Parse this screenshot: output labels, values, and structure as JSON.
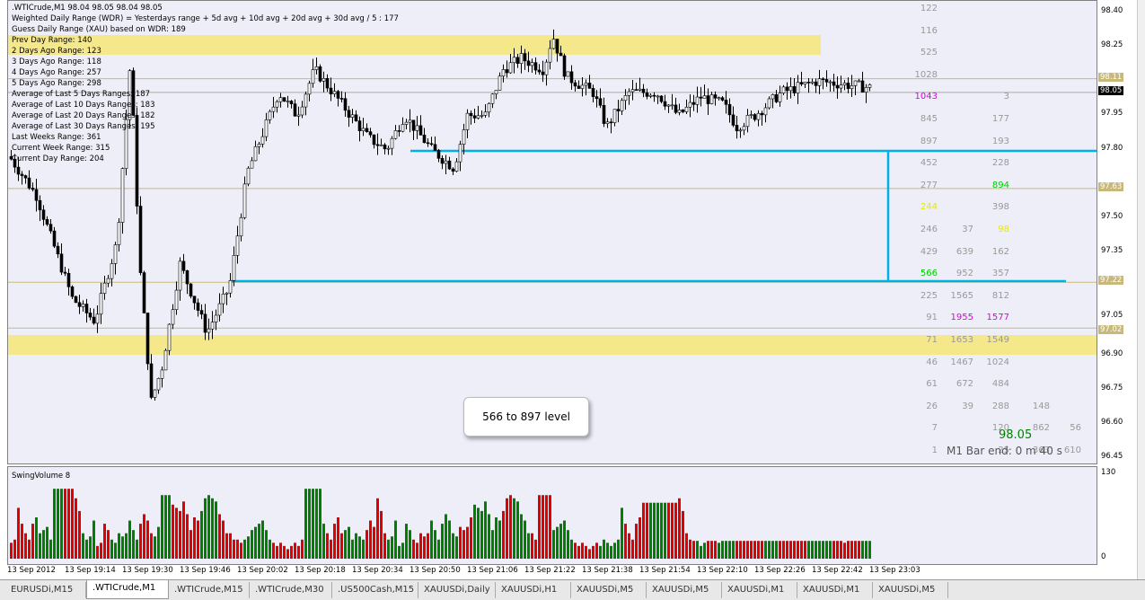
{
  "header": {
    "symbol_line": ".WTICrude,M1  98.04 98.05 98.04 98.05",
    "wdr_line": "Weighted Daily Range (WDR) = Yesterdays range + 5d avg + 10d avg + 20d avg + 30d avg / 5 : 177",
    "guess_line": "Guess Daily Range (XAU) based on WDR: 189"
  },
  "stats": [
    "Prev Day Range: 140",
    "2 Days Ago Range: 123",
    "3 Days Ago Range: 118",
    "4 Days Ago Range: 257",
    "5 Days Ago Range: 298",
    "Average of Last 5 Days Ranges: 187",
    "Average of Last 10 Days Ranges: 183",
    "Average of Last 20 Days Ranges: 182",
    "Average of Last 30 Days Ranges: 195",
    "Last Weeks Range: 361",
    "Current Week Range: 315",
    "Current Day Range: 204"
  ],
  "price_axis": [
    "98.40",
    "98.25",
    "98.11",
    "98.05",
    "97.95",
    "97.80",
    "97.63",
    "97.50",
    "97.35",
    "97.22",
    "97.05",
    "97.02",
    "96.90",
    "96.75",
    "96.60",
    "96.45"
  ],
  "price_highlights": {
    "98.11": "#c8b97a",
    "98.05": "#000000",
    "97.63": "#c8b97a",
    "97.22": "#c8b97a",
    "97.02": "#c8b97a"
  },
  "volume_profile": [
    {
      "c1": "122",
      "c2": "",
      "c3": "",
      "c4": ""
    },
    {
      "c1": "116",
      "c2": "",
      "c3": "",
      "c4": ""
    },
    {
      "c1": "525",
      "c2": "",
      "c3": "",
      "c4": ""
    },
    {
      "c1": "1028",
      "c2": "",
      "c3": "",
      "c4": ""
    },
    {
      "c1": "1043",
      "c2": "",
      "c3": "3",
      "c4": "",
      "c1color": "#e000e0"
    },
    {
      "c1": "845",
      "c2": "",
      "c3": "177",
      "c4": ""
    },
    {
      "c1": "897",
      "c2": "",
      "c3": "193",
      "c4": ""
    },
    {
      "c1": "452",
      "c2": "",
      "c3": "228",
      "c4": ""
    },
    {
      "c1": "277",
      "c2": "",
      "c3": "894",
      "c4": "",
      "c3color": "#00cc00"
    },
    {
      "c1": "244",
      "c2": "",
      "c3": "398",
      "c4": "",
      "c1color": "#e8e800"
    },
    {
      "c1": "246",
      "c2": "37",
      "c3": "98",
      "c4": "",
      "c3color": "#e8e800"
    },
    {
      "c1": "429",
      "c2": "639",
      "c3": "162",
      "c4": ""
    },
    {
      "c1": "566",
      "c2": "952",
      "c3": "357",
      "c4": "",
      "c1color": "#00cc00"
    },
    {
      "c1": "225",
      "c2": "1565",
      "c3": "812",
      "c4": ""
    },
    {
      "c1": "91",
      "c2": "1955",
      "c3": "1577",
      "c4": "",
      "c2color": "#e000e0",
      "c3color": "#e000e0"
    },
    {
      "c1": "71",
      "c2": "1653",
      "c3": "1549",
      "c4": ""
    },
    {
      "c1": "46",
      "c2": "1467",
      "c3": "1024",
      "c4": ""
    },
    {
      "c1": "61",
      "c2": "672",
      "c3": "484",
      "c4": ""
    },
    {
      "c1": "26",
      "c2": "39",
      "c3": "288",
      "c4": "148"
    },
    {
      "c1": "7",
      "c2": "",
      "c3": "120",
      "c4": "862",
      "c5": "56"
    },
    {
      "c1": "1",
      "c2": "",
      "c3": "25",
      "c4": "363",
      "c5": "610"
    }
  ],
  "current_price": "98.05",
  "bar_end": "M1 Bar end: 0 m 40 s",
  "callout": "566 to 897 level",
  "indicator": {
    "name": "SwingVolume 8",
    "max_label": "130",
    "min_label": "0"
  },
  "time_axis": [
    "13 Sep 2012",
    "13 Sep 19:14",
    "13 Sep 19:30",
    "13 Sep 19:46",
    "13 Sep 20:02",
    "13 Sep 20:18",
    "13 Sep 20:34",
    "13 Sep 20:50",
    "13 Sep 21:06",
    "13 Sep 21:22",
    "13 Sep 21:38",
    "13 Sep 21:54",
    "13 Sep 22:10",
    "13 Sep 22:26",
    "13 Sep 22:42",
    "13 Sep 23:03"
  ],
  "tabs": [
    "EURUSDi,M15",
    ".WTICrude,M1",
    ".WTICrude,M15",
    ".WTICrude,M30",
    ".US500Cash,M15",
    "XAUUSDi,Daily",
    "XAUUSDi,H1",
    "XAUUSDi,M5",
    "XAUUSDi,M5",
    "XAUUSDi,M1",
    "XAUUSDi,M1",
    "XAUUSDi,M5"
  ],
  "active_tab": 1,
  "colors": {
    "bull": "#008000",
    "bear": "#e00000",
    "zone": "#f5e88a",
    "level_line": "#00b0e8",
    "grid": "#c8c8d8"
  }
}
